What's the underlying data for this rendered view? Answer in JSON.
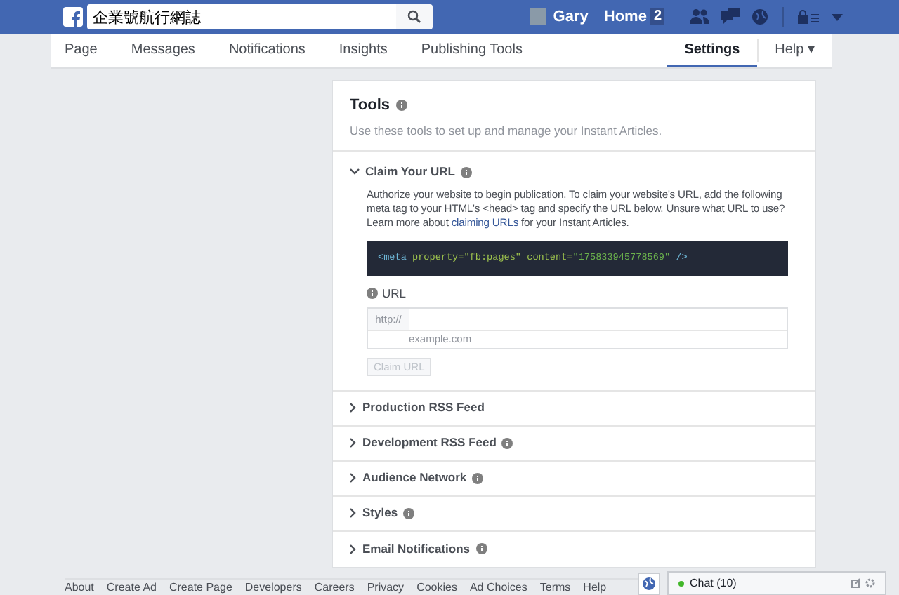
{
  "topbar": {
    "search": {
      "value": "企業號航行網誌"
    },
    "user": "Gary",
    "home": "Home",
    "home_count": "2"
  },
  "nav": {
    "tabs": [
      {
        "label": "Page",
        "selected": false
      },
      {
        "label": "Messages",
        "selected": false
      },
      {
        "label": "Notifications",
        "selected": false
      },
      {
        "label": "Insights",
        "selected": false
      },
      {
        "label": "Publishing Tools",
        "selected": false
      }
    ],
    "right_tabs": [
      {
        "label": "Settings",
        "selected": true
      },
      {
        "label": "Help ▾",
        "selected": false
      }
    ]
  },
  "tools": {
    "title": "Tools",
    "subtitle": "Use these tools to set up and manage your Instant Articles.",
    "sections": [
      {
        "title": "Claim Your URL",
        "info": true,
        "expanded": true,
        "description": "Authorize your website to begin publication. To claim your website's URL, add the following meta tag to your HTML's <head> tag and specify the URL below. Unsure what URL to use? Learn more about ",
        "link": "claiming URLs",
        "description_end": " for your Instant Articles.",
        "code": {
          "tag": "<meta",
          "attr1": "property=",
          "val1": "\"fb:pages\"",
          "attr2": "content=",
          "val2": "\"175833945778569\"",
          "end": "/>"
        },
        "url_label": "URL",
        "prefix": "http://",
        "placeholder": "example.com",
        "button": {
          "label": "Claim URL",
          "disabled": true
        }
      },
      {
        "title": "Production RSS Feed",
        "info": false,
        "expanded": false
      },
      {
        "title": "Development RSS Feed",
        "info": true,
        "expanded": false
      },
      {
        "title": "Audience Network",
        "info": true,
        "expanded": false
      },
      {
        "title": "Styles",
        "info": true,
        "expanded": false
      },
      {
        "title": "Email Notifications",
        "info": true,
        "expanded": false
      }
    ]
  },
  "footer": [
    "About",
    "Create Ad",
    "Create Page",
    "Developers",
    "Careers",
    "Privacy",
    "Cookies",
    "Ad Choices",
    "Terms",
    "Help"
  ],
  "chat": {
    "label": "Chat (10)"
  }
}
